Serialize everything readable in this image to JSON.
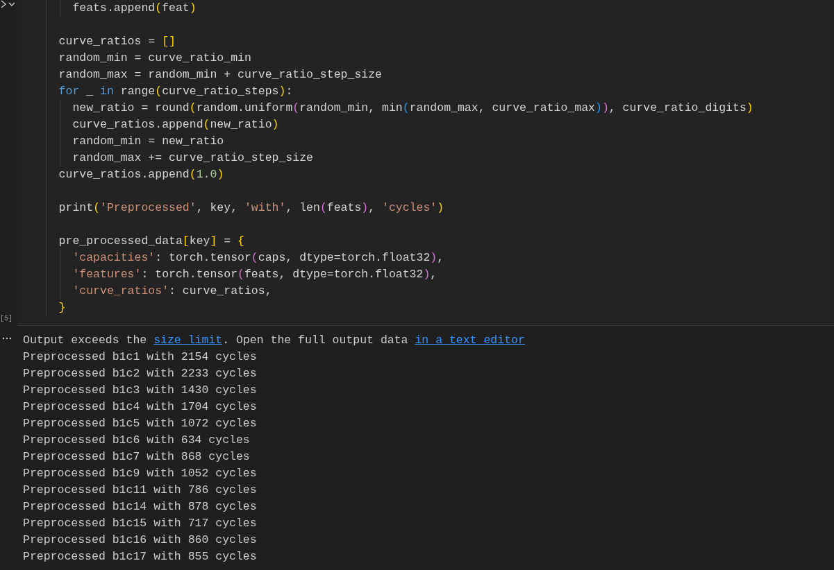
{
  "cell": {
    "execution_count": "[5]",
    "code_lines": [
      {
        "spaced": false,
        "tokens": [
          {
            "text": "      feats.append",
            "kind": "plain"
          },
          {
            "text": "(",
            "kind": "bracket1"
          },
          {
            "text": "feat",
            "kind": "plain"
          },
          {
            "text": ")",
            "kind": "bracket1"
          }
        ]
      },
      {
        "spaced": true,
        "tokens": [
          {
            "text": "    curve_ratios = ",
            "kind": "plain"
          },
          {
            "text": "[]",
            "kind": "bracket1"
          }
        ]
      },
      {
        "spaced": false,
        "tokens": [
          {
            "text": "    random_min = curve_ratio_min",
            "kind": "plain"
          }
        ]
      },
      {
        "spaced": false,
        "tokens": [
          {
            "text": "    random_max = random_min + curve_ratio_step_size",
            "kind": "plain"
          }
        ]
      },
      {
        "spaced": false,
        "tokens": [
          {
            "text": "    for",
            "kind": "keyword"
          },
          {
            "text": " _ ",
            "kind": "plain"
          },
          {
            "text": "in",
            "kind": "keyword"
          },
          {
            "text": " range",
            "kind": "plain"
          },
          {
            "text": "(",
            "kind": "bracket1"
          },
          {
            "text": "curve_ratio_steps",
            "kind": "plain"
          },
          {
            "text": ")",
            "kind": "bracket1"
          },
          {
            "text": ":",
            "kind": "plain"
          }
        ]
      },
      {
        "spaced": false,
        "tokens": [
          {
            "text": "      new_ratio = round",
            "kind": "plain"
          },
          {
            "text": "(",
            "kind": "bracket1"
          },
          {
            "text": "random.uniform",
            "kind": "plain"
          },
          {
            "text": "(",
            "kind": "bracket2"
          },
          {
            "text": "random_min, min",
            "kind": "plain"
          },
          {
            "text": "(",
            "kind": "bracket3"
          },
          {
            "text": "random_max, curve_ratio_max",
            "kind": "plain"
          },
          {
            "text": ")",
            "kind": "bracket3"
          },
          {
            "text": ")",
            "kind": "bracket2"
          },
          {
            "text": ", curve_ratio_digits",
            "kind": "plain"
          },
          {
            "text": ")",
            "kind": "bracket1"
          }
        ]
      },
      {
        "spaced": false,
        "tokens": [
          {
            "text": "      curve_ratios.append",
            "kind": "plain"
          },
          {
            "text": "(",
            "kind": "bracket1"
          },
          {
            "text": "new_ratio",
            "kind": "plain"
          },
          {
            "text": ")",
            "kind": "bracket1"
          }
        ]
      },
      {
        "spaced": false,
        "tokens": [
          {
            "text": "      random_min = new_ratio",
            "kind": "plain"
          }
        ]
      },
      {
        "spaced": false,
        "tokens": [
          {
            "text": "      random_max += curve_ratio_step_size",
            "kind": "plain"
          }
        ]
      },
      {
        "spaced": false,
        "tokens": [
          {
            "text": "    curve_ratios.append",
            "kind": "plain"
          },
          {
            "text": "(",
            "kind": "bracket1"
          },
          {
            "text": "1.0",
            "kind": "number"
          },
          {
            "text": ")",
            "kind": "bracket1"
          }
        ]
      },
      {
        "spaced": true,
        "tokens": [
          {
            "text": "    print",
            "kind": "plain"
          },
          {
            "text": "(",
            "kind": "bracket1"
          },
          {
            "text": "'Preprocessed'",
            "kind": "string"
          },
          {
            "text": ", key, ",
            "kind": "plain"
          },
          {
            "text": "'with'",
            "kind": "string"
          },
          {
            "text": ", len",
            "kind": "plain"
          },
          {
            "text": "(",
            "kind": "bracket2"
          },
          {
            "text": "feats",
            "kind": "plain"
          },
          {
            "text": ")",
            "kind": "bracket2"
          },
          {
            "text": ", ",
            "kind": "plain"
          },
          {
            "text": "'cycles'",
            "kind": "string"
          },
          {
            "text": ")",
            "kind": "bracket1"
          }
        ]
      },
      {
        "spaced": true,
        "tokens": [
          {
            "text": "    pre_processed_data",
            "kind": "plain"
          },
          {
            "text": "[",
            "kind": "bracket1"
          },
          {
            "text": "key",
            "kind": "plain"
          },
          {
            "text": "]",
            "kind": "bracket1"
          },
          {
            "text": " = ",
            "kind": "plain"
          },
          {
            "text": "{",
            "kind": "bracket1"
          }
        ]
      },
      {
        "spaced": false,
        "tokens": [
          {
            "text": "      'capacities'",
            "kind": "string"
          },
          {
            "text": ": torch.tensor",
            "kind": "plain"
          },
          {
            "text": "(",
            "kind": "bracket2"
          },
          {
            "text": "caps, dtype=torch.float32",
            "kind": "plain"
          },
          {
            "text": ")",
            "kind": "bracket2"
          },
          {
            "text": ",",
            "kind": "plain"
          }
        ]
      },
      {
        "spaced": false,
        "tokens": [
          {
            "text": "      'features'",
            "kind": "string"
          },
          {
            "text": ": torch.tensor",
            "kind": "plain"
          },
          {
            "text": "(",
            "kind": "bracket2"
          },
          {
            "text": "feats, dtype=torch.float32",
            "kind": "plain"
          },
          {
            "text": ")",
            "kind": "bracket2"
          },
          {
            "text": ",",
            "kind": "plain"
          }
        ]
      },
      {
        "spaced": false,
        "tokens": [
          {
            "text": "      'curve_ratios'",
            "kind": "string"
          },
          {
            "text": ": curve_ratios,",
            "kind": "plain"
          }
        ]
      },
      {
        "spaced": false,
        "tokens": [
          {
            "text": "    }",
            "kind": "bracket1"
          }
        ]
      }
    ]
  },
  "output": {
    "notice": [
      {
        "text": "Output exceeds the ",
        "kind": "text"
      },
      {
        "text": "size limit",
        "kind": "link"
      },
      {
        "text": ". Open the full output data ",
        "kind": "text"
      },
      {
        "text": "in a text editor",
        "kind": "link"
      }
    ],
    "lines": [
      "Preprocessed b1c1 with 2154 cycles",
      "Preprocessed b1c2 with 2233 cycles",
      "Preprocessed b1c3 with 1430 cycles",
      "Preprocessed b1c4 with 1704 cycles",
      "Preprocessed b1c5 with 1072 cycles",
      "Preprocessed b1c6 with 634 cycles",
      "Preprocessed b1c7 with 868 cycles",
      "Preprocessed b1c9 with 1052 cycles",
      "Preprocessed b1c11 with 786 cycles",
      "Preprocessed b1c14 with 878 cycles",
      "Preprocessed b1c15 with 717 cycles",
      "Preprocessed b1c16 with 860 cycles",
      "Preprocessed b1c17 with 855 cycles"
    ]
  }
}
